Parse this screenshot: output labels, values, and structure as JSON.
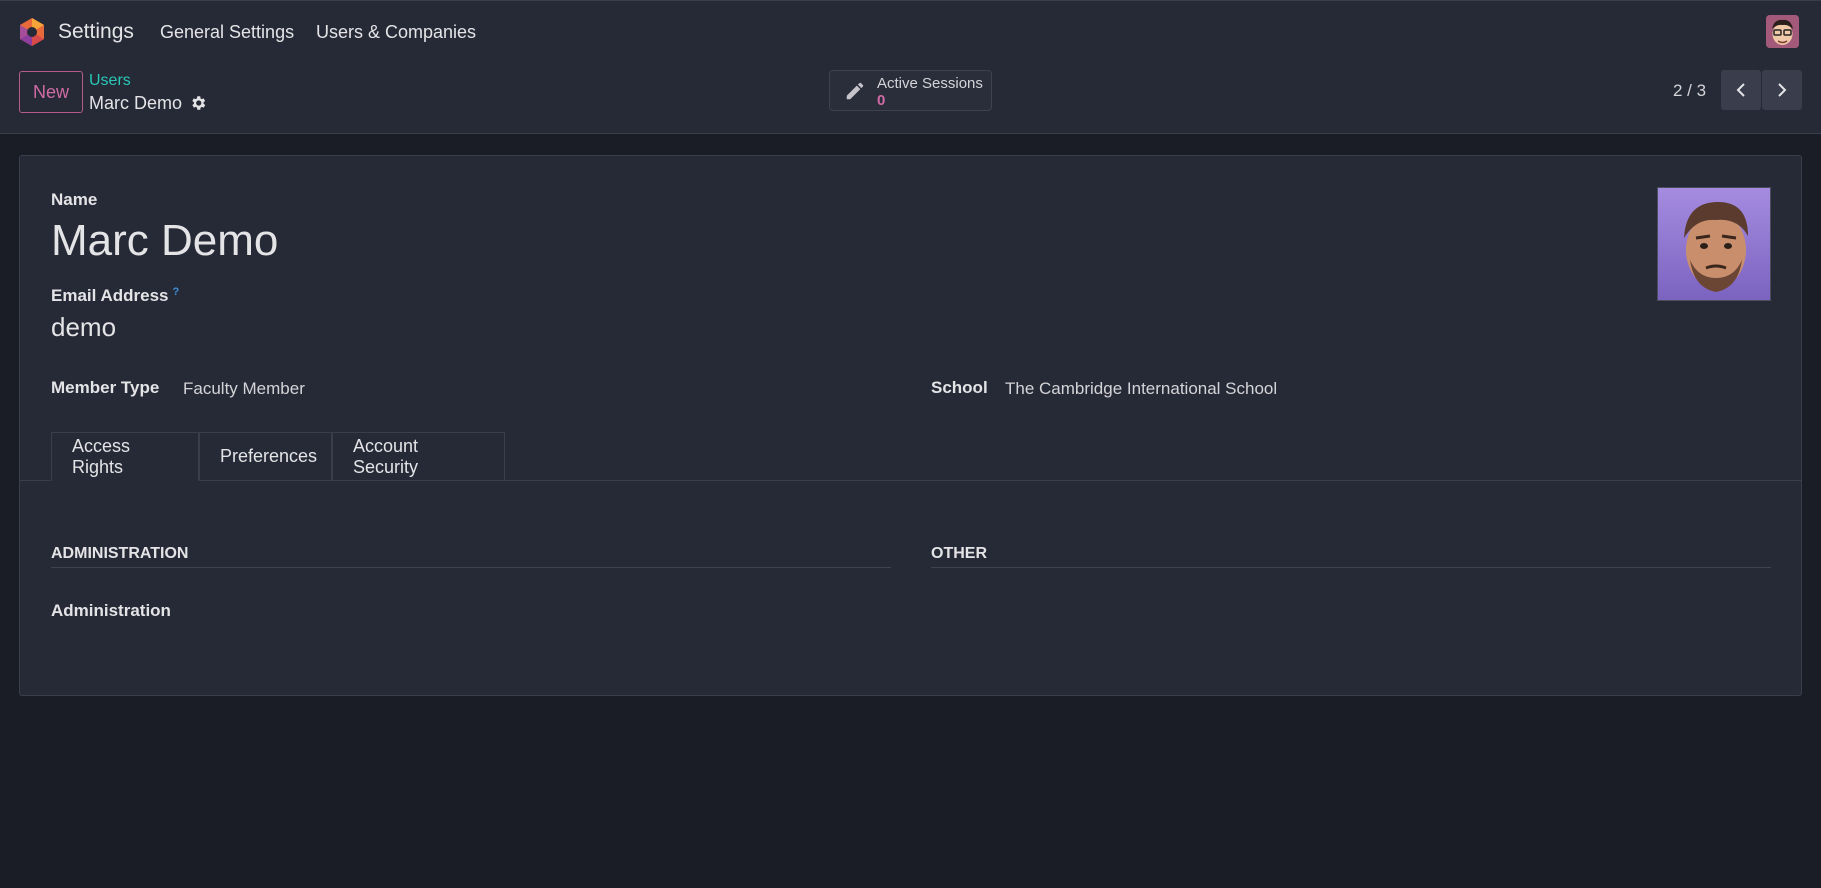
{
  "navbar": {
    "app_name": "Settings",
    "menu": [
      "General Settings",
      "Users & Companies"
    ]
  },
  "control": {
    "new_label": "New",
    "breadcrumb_parent": "Users",
    "breadcrumb_current": "Marc Demo",
    "smart_button": {
      "label": "Active Sessions",
      "value": "0"
    },
    "pager": "2 / 3"
  },
  "form": {
    "name_label": "Name",
    "name_value": "Marc Demo",
    "email_label": "Email Address",
    "email_help": "?",
    "email_value": "demo",
    "member_type_label": "Member Type",
    "member_type_value": "Faculty Member",
    "school_label": "School",
    "school_value": "The Cambridge International School"
  },
  "tabs": [
    "Access Rights",
    "Preferences",
    "Account Security"
  ],
  "access_rights": {
    "section_left": "ADMINISTRATION",
    "section_right": "OTHER",
    "field_label": "Administration"
  },
  "colors": {
    "accent": "#d16ba5",
    "link": "#28c7b7",
    "background": "#1b1d26",
    "panel": "#262a36"
  },
  "icons": [
    "odoo-logo-icon",
    "user-avatar",
    "gear-icon",
    "pencil-icon",
    "chevron-left-icon",
    "chevron-right-icon"
  ]
}
